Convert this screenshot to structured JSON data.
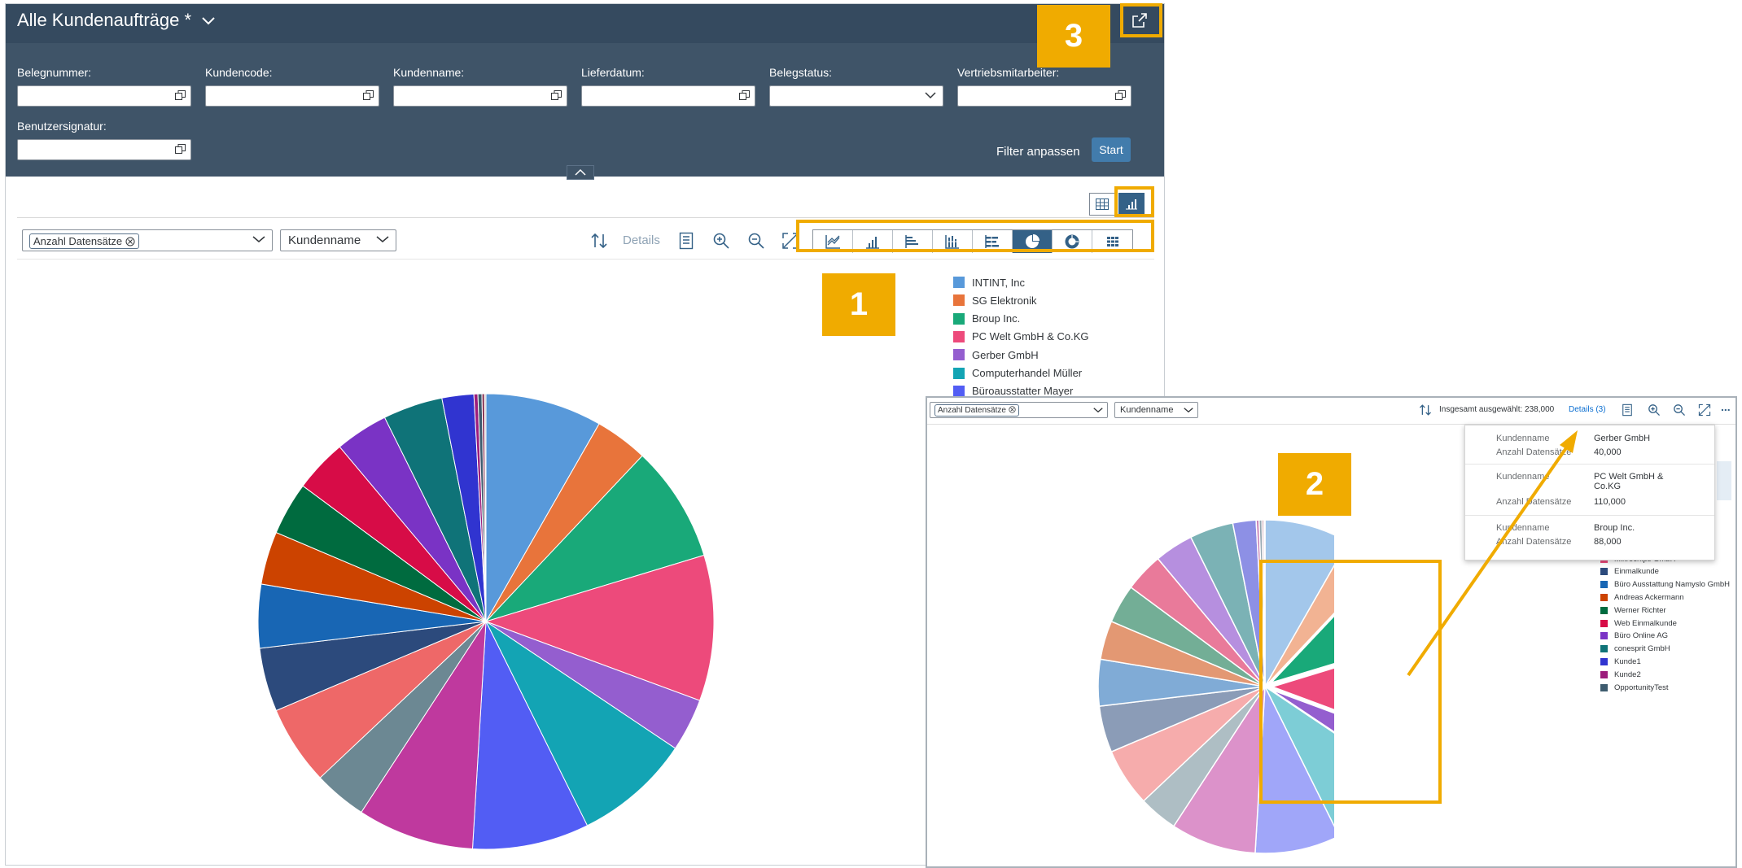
{
  "app": {
    "title": "Alle Kundenaufträge *"
  },
  "filters": {
    "belegnummer_label": "Belegnummer:",
    "kundencode_label": "Kundencode:",
    "kundenname_label": "Kundenname:",
    "lieferdatum_label": "Lieferdatum:",
    "belegstatus_label": "Belegstatus:",
    "vertrieb_label": "Vertriebsmitarbeiter:",
    "benutzer_label": "Benutzersignatur:",
    "adjust_label": "Filter anpassen",
    "start_label": "Start"
  },
  "toolbar": {
    "measure_token": "Anzahl Datensätze",
    "dimension_select": "Kundenname",
    "details_label": "Details"
  },
  "legend": [
    {
      "label": "INTINT, Inc",
      "color": "#5899da"
    },
    {
      "label": "SG Elektronik",
      "color": "#e8743b"
    },
    {
      "label": "Broup Inc.",
      "color": "#19a979"
    },
    {
      "label": "PC Welt GmbH & Co.KG",
      "color": "#ed4a7b"
    },
    {
      "label": "Gerber GmbH",
      "color": "#945ecf"
    },
    {
      "label": "Computerhandel Müller",
      "color": "#13a4b4"
    },
    {
      "label": "Büroausstatter Mayer",
      "color": "#525df4"
    }
  ],
  "markers": {
    "m1": "1",
    "m2": "2",
    "m3": "3"
  },
  "overlay": {
    "measure_token": "Anzahl Datensätze",
    "dimension_select": "Kundenname",
    "total_selected": "Insgesamt ausgewählt: 238,000",
    "details_link": "Details (3)",
    "more": "...",
    "popover": [
      {
        "label1": "Kundenname",
        "value1": "Gerber GmbH",
        "label2": "Anzahl Datensätze",
        "value2": "40,000"
      },
      {
        "label1": "Kundenname",
        "value1": "PC Welt GmbH & Co.KG",
        "label2": "Anzahl Datensätze",
        "value2": "110,000"
      },
      {
        "label1": "Kundenname",
        "value1": "Broup Inc.",
        "label2": "Anzahl Datensätze",
        "value2": "88,000"
      }
    ],
    "legend": [
      {
        "label": "Mikrochips GmbH",
        "color": "#ed4a7b"
      },
      {
        "label": "Einmalkunde",
        "color": "#2c4a7c"
      },
      {
        "label": "Büro Ausstattung Namyslo GmbH",
        "color": "#1866b4"
      },
      {
        "label": "Andreas Ackermann",
        "color": "#cc4300"
      },
      {
        "label": "Werner Richter",
        "color": "#006b3f"
      },
      {
        "label": "Web Einmalkunde",
        "color": "#d70c47"
      },
      {
        "label": "Büro Online AG",
        "color": "#7a33c5"
      },
      {
        "label": "conesprit GmbH",
        "color": "#0f7378"
      },
      {
        "label": "Kunde1",
        "color": "#3034d0"
      },
      {
        "label": "Kunde2",
        "color": "#9c1d7c"
      },
      {
        "label": "OpportunityTest",
        "color": "#3d5b6e"
      }
    ]
  },
  "chart_data": {
    "type": "pie",
    "categories": [
      "INTINT, Inc",
      "SG Elektronik",
      "Broup Inc.",
      "PC Welt GmbH & Co.KG",
      "Gerber GmbH",
      "Computerhandel Müller",
      "Büroausstatter Mayer",
      "",
      "",
      "",
      "",
      "",
      "",
      "",
      "",
      "",
      "",
      "",
      "",
      "",
      "",
      ""
    ],
    "values": [
      88,
      40,
      88,
      110,
      40,
      88,
      88,
      88,
      40,
      60,
      48,
      48,
      40,
      40,
      40,
      40,
      45,
      24,
      3,
      3,
      2,
      1
    ],
    "colors": [
      "#5899da",
      "#e8743b",
      "#19a979",
      "#ed4a7b",
      "#945ecf",
      "#13a4b4",
      "#525df4",
      "#bf399e",
      "#6c8893",
      "#ee6868",
      "#2c4a7c",
      "#1866b4",
      "#cc4300",
      "#006b3f",
      "#d70c47",
      "#7a33c5",
      "#0f7378",
      "#3034d0",
      "#9c1d7c",
      "#3d5b6e",
      "#8c3a5a",
      "#c0c0c0"
    ]
  }
}
